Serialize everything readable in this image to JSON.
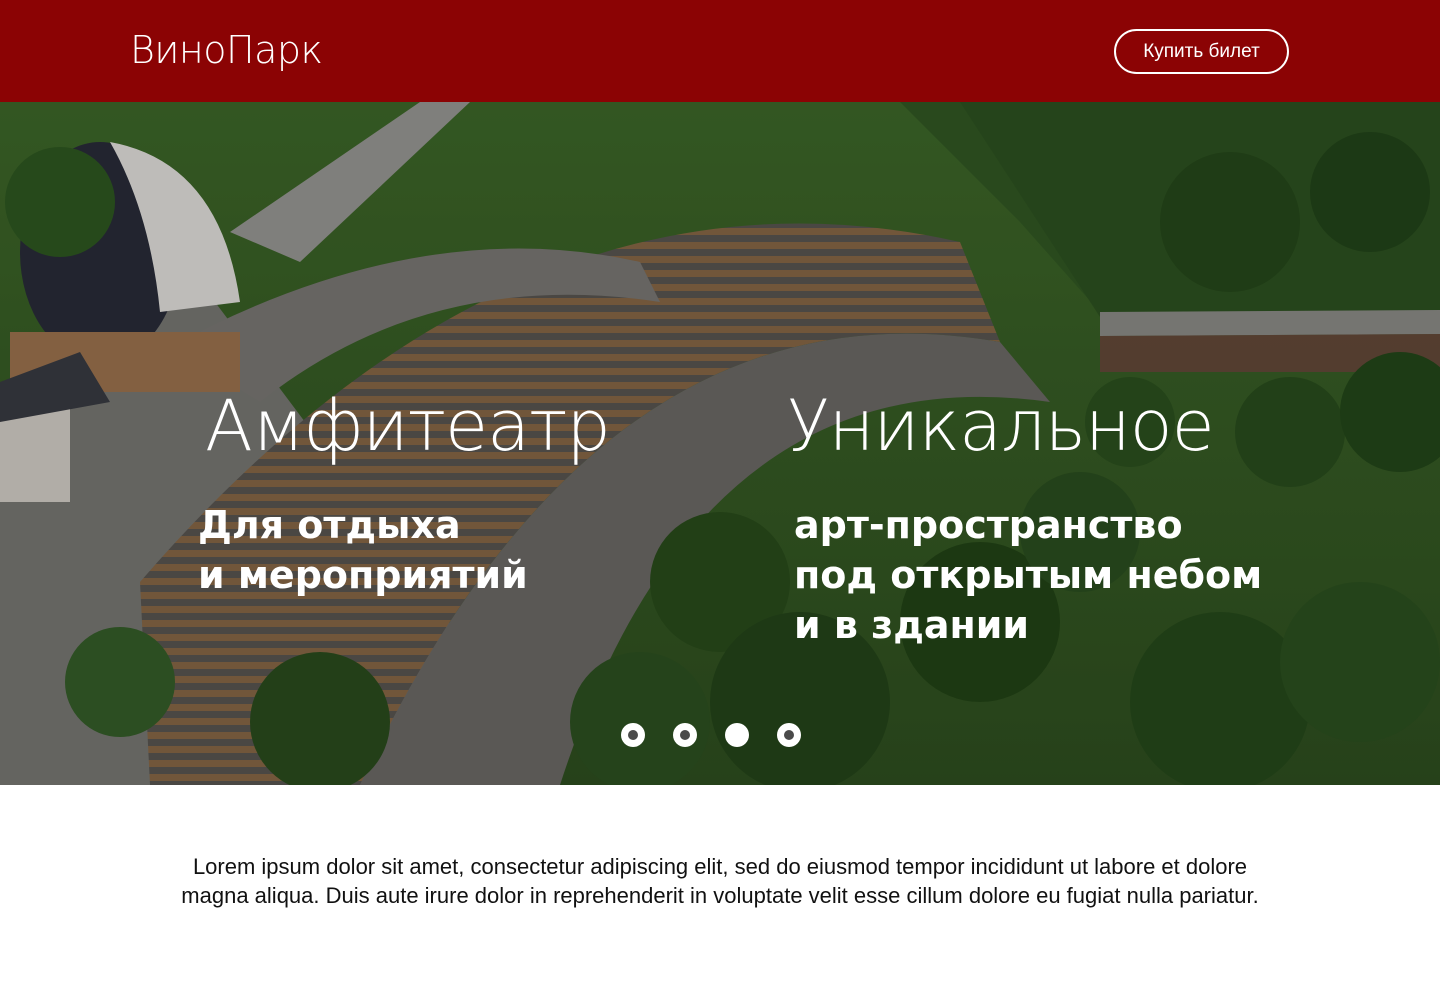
{
  "header": {
    "logo": "ВиноПарк",
    "buy_button": "Купить билет"
  },
  "hero": {
    "left": {
      "title": "Амфитеатр",
      "lines": [
        "Для отдыха",
        "и мероприятий"
      ]
    },
    "right": {
      "title": "Уникальное",
      "lines": [
        "арт-пространство",
        "под открытым небом",
        "и в здании"
      ]
    },
    "slider": {
      "count": 4,
      "active_index": 3
    }
  },
  "content": {
    "text": "Lorem ipsum dolor sit amet, consectetur adipiscing elit, sed do eiusmod tempor incididunt ut labore et dolore magna aliqua. Duis aute irure dolor in reprehenderit in voluptate velit esse cillum dolore eu fugiat nulla pariatur."
  },
  "colors": {
    "header_bg": "#8b0304",
    "text_light": "#ffffff"
  }
}
